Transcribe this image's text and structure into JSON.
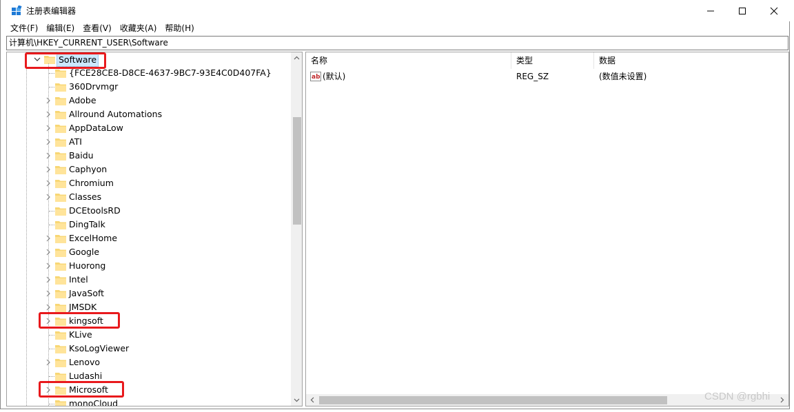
{
  "window": {
    "title": "注册表编辑器",
    "app_icon": "regedit-icon"
  },
  "menu": [
    "文件(F)",
    "编辑(E)",
    "查看(V)",
    "收藏夹(A)",
    "帮助(H)"
  ],
  "address": "计算机\\HKEY_CURRENT_USER\\Software",
  "tree": {
    "root": {
      "label": "Software",
      "expanded": true,
      "selected": true
    },
    "children": [
      {
        "label": "{FCE28CE8-D8CE-4637-9BC7-93E4C0D407FA}",
        "expandable": false
      },
      {
        "label": "360Drvmgr",
        "expandable": false
      },
      {
        "label": "Adobe",
        "expandable": true
      },
      {
        "label": "Allround Automations",
        "expandable": true
      },
      {
        "label": "AppDataLow",
        "expandable": true
      },
      {
        "label": "ATI",
        "expandable": true
      },
      {
        "label": "Baidu",
        "expandable": true
      },
      {
        "label": "Caphyon",
        "expandable": true
      },
      {
        "label": "Chromium",
        "expandable": true
      },
      {
        "label": "Classes",
        "expandable": true
      },
      {
        "label": "DCEtoolsRD",
        "expandable": false
      },
      {
        "label": "DingTalk",
        "expandable": false
      },
      {
        "label": "ExcelHome",
        "expandable": true
      },
      {
        "label": "Google",
        "expandable": true
      },
      {
        "label": "Huorong",
        "expandable": true
      },
      {
        "label": "Intel",
        "expandable": true
      },
      {
        "label": "JavaSoft",
        "expandable": true
      },
      {
        "label": "JMSDK",
        "expandable": true
      },
      {
        "label": "kingsoft",
        "expandable": true
      },
      {
        "label": "KLive",
        "expandable": false
      },
      {
        "label": "KsoLogViewer",
        "expandable": false
      },
      {
        "label": "Lenovo",
        "expandable": true
      },
      {
        "label": "Ludashi",
        "expandable": false
      },
      {
        "label": "Microsoft",
        "expandable": true
      },
      {
        "label": "monoCloud",
        "expandable": false
      }
    ]
  },
  "list": {
    "columns": [
      "名称",
      "类型",
      "数据"
    ],
    "rows": [
      {
        "name": "(默认)",
        "type": "REG_SZ",
        "data": "(数值未设置)",
        "icon": "string-value-icon"
      }
    ]
  },
  "annotations": {
    "color": "#e8191c",
    "highlighted": [
      "Software",
      "kingsoft",
      "Microsoft"
    ]
  },
  "watermark": "CSDN @rgbhi"
}
